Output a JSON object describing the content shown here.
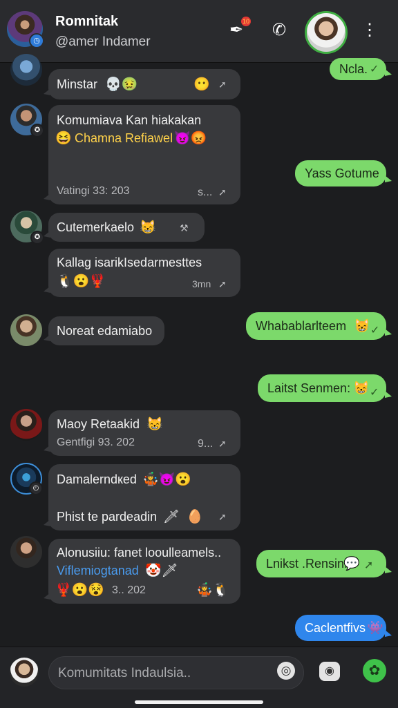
{
  "header": {
    "title": "Romnitak",
    "subtitle": "@amer Indamer",
    "quill_badge": "10",
    "icons": {
      "quill": "quill-icon",
      "call": "phone-icon",
      "more": "more-vertical-icon"
    }
  },
  "messages": {
    "m1": {
      "text": "Minstar"
    },
    "out1": {
      "text": "Ncla."
    },
    "m2": {
      "line1": "Komumiava Kan hiakakan",
      "line2": "Chamna Refiawel",
      "time": "Vatingi 33: 203",
      "meta_end": "s..."
    },
    "out2": {
      "text": "Yass Gotume"
    },
    "m3": {
      "text": "Cutemerkaelo"
    },
    "m4": {
      "text": "Kallag isarikIsedarmesttes",
      "time": "3mn"
    },
    "m5": {
      "text": "Noreat edamiabo"
    },
    "out3": {
      "text": "Whabablarlteem"
    },
    "out4": {
      "text": "Laitst Senmen:"
    },
    "m6": {
      "line1": "Maoy Retaakid",
      "time": "Gentfigi 93. 202",
      "meta_end": "9..."
    },
    "m7": {
      "line1": "Damalerndкed",
      "line2": "Phist te pardeadin"
    },
    "m8": {
      "line1": "Alonusiiu: fanet looulleamels..",
      "line2": "Viflemiogtanad",
      "time": "3.. 202"
    },
    "out5": {
      "text": "Lnikst .Rensin."
    },
    "out6": {
      "text": "Caclentfivs"
    }
  },
  "composer": {
    "placeholder": "Komumitats Indaulsia..",
    "icons": {
      "attach": "gear-icon",
      "camera": "camera-icon",
      "send": "send-icon"
    }
  },
  "colors": {
    "outgoing": "#7cd96b",
    "incoming": "#38393c",
    "blue": "#2f86ec",
    "accent_green": "#3fc24a"
  }
}
